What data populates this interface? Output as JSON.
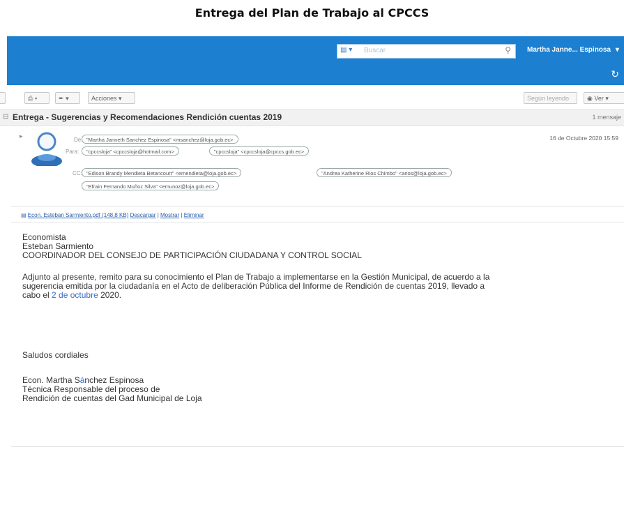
{
  "doc_title": "Entrega del Plan de Trabajo al CPCCS",
  "topbar": {
    "search_placeholder": "Buscar",
    "user_name": "Martha Janne... Espinosa",
    "user_caret": "▾",
    "refresh_icon": "↻",
    "colors": {
      "bar": "#1c7fd0"
    }
  },
  "toolbar": {
    "acciones_label": "Acciones",
    "caret": "▾",
    "sort_label": "Según leyendo",
    "ver_label": "Ver"
  },
  "message": {
    "subject": "Entrega - Sugerencias y Recomendaciones Rendición cuentas 2019",
    "message_count": "1 mensaje",
    "date": "16 de Octubre 2020 15:59",
    "from_label": "De:",
    "from": "\"Martha Janneth Sanchez Espinosa\" <msanchez@loja.gob.ec>",
    "to_label": "Para:",
    "to": [
      "\"cpccsloja\" <cpccsloja@hotmail.com>",
      "\"cpccsloja\" <cpccsloja@cpccs.gob.ec>"
    ],
    "cc_label": "CC:",
    "cc": [
      "\"Edison Brandy Mendieta Betancourt\" <emendieta@loja.gob.ec>",
      "\"Andrea Katherine Rios Chimbo\" <arios@loja.gob.ec>",
      "\"Efrain Fernando Muñoz Silva\" <emunoz@loja.gob.ec>"
    ],
    "attachment": {
      "file": "Econ. Esteban Sarmiento.pdf (148,8 KB)",
      "download": "Descargar",
      "sep1": "|",
      "show": "Mostrar",
      "sep2": "|",
      "remove": "Eliminar"
    },
    "body": {
      "line1": "Economista",
      "line2": "Esteban Sarmiento",
      "line3": "COORDINADOR DEL CONSEJO DE PARTICIPACIÓN CIUDADANA Y CONTROL SOCIAL",
      "para1": "Adjunto al presente, remito para su conocimiento  el Plan de Trabajo a implementarse en la Gestión Municipal, de acuerdo a la",
      "para2": "sugerencia emitida por la ciudadanía en el Acto de deliberación Pública del Informe de Rendición de cuentas 2019, llevado a",
      "para3_a": "cabo el ",
      "para3_link": "2 de octubre",
      "para3_b": " 2020.",
      "greeting": "Saludos cordiales",
      "sig1_a": "Econ. Martha S",
      "sig1_hl": "á",
      "sig1_b": "nchez Espinosa",
      "sig2": "Técnica Responsable del proceso de",
      "sig3": "Rendición de cuentas del Gad Municipal de Loja"
    }
  }
}
